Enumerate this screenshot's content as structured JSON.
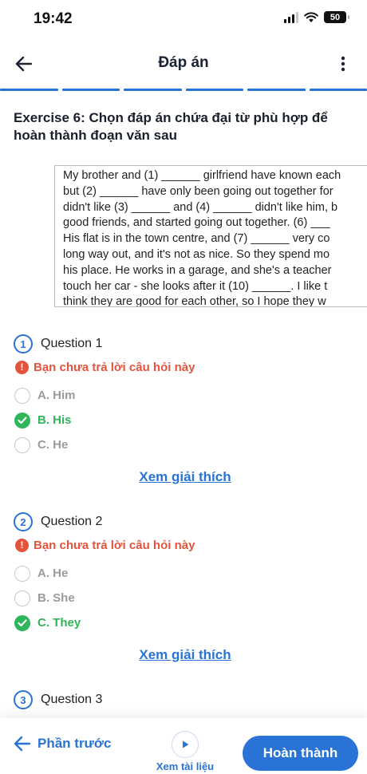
{
  "status_bar": {
    "time": "19:42",
    "battery": "50"
  },
  "header": {
    "title": "Đáp án"
  },
  "exercise": {
    "title": "Exercise 6: Chọn đáp án chứa đại từ phù hợp để hoàn thành đoạn văn sau",
    "passage_lines": [
      "My brother and (1) ______ girlfriend have known each",
      "but (2) ______ have only been going out together for",
      "didn't like (3) ______ and (4) ______ didn't like him, b",
      "good friends, and started going out together. (6) ___",
      "His flat is in the town centre, and (7) ______ very co",
      "long way out, and it's not as nice. So they spend mo",
      "his place. He works in a garage, and she's a teacher",
      "touch her car - she looks after it (10) ______. I  like t",
      "think they are good for each other, so I hope they w"
    ]
  },
  "questions": [
    {
      "number": "1",
      "label": "Question 1",
      "warning": "Bạn chưa trả lời câu hỏi này",
      "options": [
        {
          "text": "A. Him",
          "state": "normal"
        },
        {
          "text": "B. His",
          "state": "correct"
        },
        {
          "text": "C. He",
          "state": "normal"
        }
      ],
      "explain_label": "Xem giải thích"
    },
    {
      "number": "2",
      "label": "Question 2",
      "warning": "Bạn chưa trả lời câu hỏi này",
      "options": [
        {
          "text": "A. He",
          "state": "normal"
        },
        {
          "text": "B. She",
          "state": "normal"
        },
        {
          "text": "C. They",
          "state": "correct"
        }
      ],
      "explain_label": "Xem giải thích"
    },
    {
      "number": "3",
      "label": "Question 3"
    }
  ],
  "bottom_bar": {
    "prev_label": "Phần trước",
    "docs_label": "Xem tài liệu",
    "done_label": "Hoàn thành"
  },
  "colors": {
    "accent": "#2a73d6",
    "correct": "#2fb55a",
    "warning": "#e5533d",
    "muted": "#9b9b9b"
  }
}
